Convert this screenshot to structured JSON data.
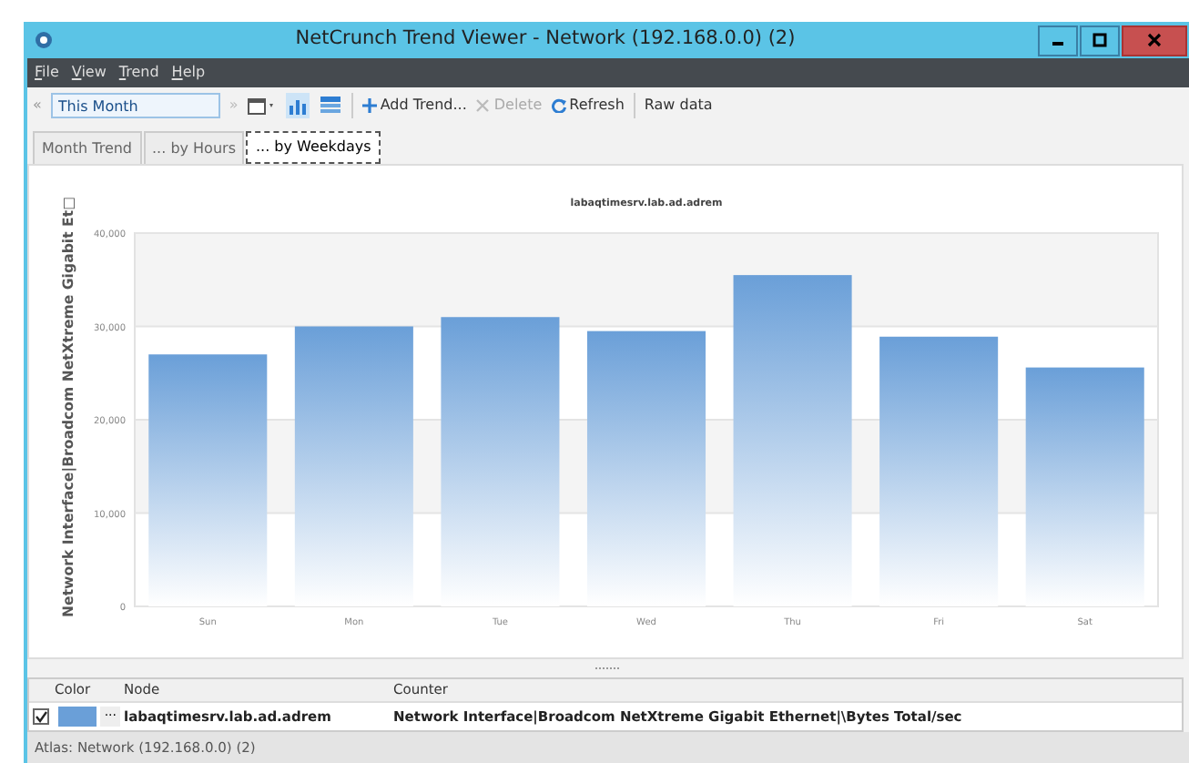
{
  "window": {
    "title": "NetCrunch Trend Viewer - Network (192.168.0.0) (2)"
  },
  "menu": [
    {
      "label": "File"
    },
    {
      "label": "View"
    },
    {
      "label": "Trend"
    },
    {
      "label": "Help"
    }
  ],
  "toolbar": {
    "back": "«",
    "period": "This Month",
    "forward": "»",
    "views": [
      {
        "kind": "chart",
        "selected": true
      },
      {
        "kind": "table",
        "selected": false
      }
    ],
    "actions": [
      {
        "kind": "add",
        "label": "Add Trend...",
        "disabled": false
      },
      {
        "kind": "delete",
        "label": "Delete",
        "disabled": true
      },
      {
        "kind": "refresh",
        "label": "Refresh",
        "disabled": false
      }
    ],
    "raw": "Raw data"
  },
  "tabs": [
    {
      "label": "Month Trend",
      "selected": false
    },
    {
      "label": "... by Hours",
      "selected": false
    },
    {
      "label": "... by Weekdays",
      "selected": true
    }
  ],
  "chart": {
    "chart_data": {
      "type": "bar",
      "title": "labaqtimesrv.lab.ad.adrem",
      "ylabel": "Network Interface|Broadcom NetXtreme Gigabit Et□",
      "categories": [
        "Sun",
        "Mon",
        "Tue",
        "Wed",
        "Thu",
        "Fri",
        "Sat"
      ],
      "grid": true,
      "series": [
        {
          "color": "#6a9fd8",
          "values": [
            27000,
            30000,
            31000,
            29500,
            35500,
            28900,
            25600
          ]
        }
      ],
      "ylim": [
        0,
        40000
      ],
      "yticks": [
        {
          "value": 0,
          "label": "0"
        },
        {
          "value": 10000,
          "label": "10,000"
        },
        {
          "value": 20000,
          "label": "20,000"
        },
        {
          "value": 30000,
          "label": "30,000"
        },
        {
          "value": 40000,
          "label": "40,000"
        }
      ]
    }
  },
  "grid": {
    "columns": [
      "Color",
      "Node",
      "Counter"
    ],
    "rows": [
      {
        "checked": true,
        "color": "#6a9fd8",
        "more": "···",
        "node": "labaqtimesrv.lab.ad.adrem",
        "counter": "Network Interface|Broadcom NetXtreme Gigabit Ethernet|\\Bytes Total/sec"
      }
    ]
  },
  "status_bar": "Atlas: Network (192.168.0.0) (2)"
}
